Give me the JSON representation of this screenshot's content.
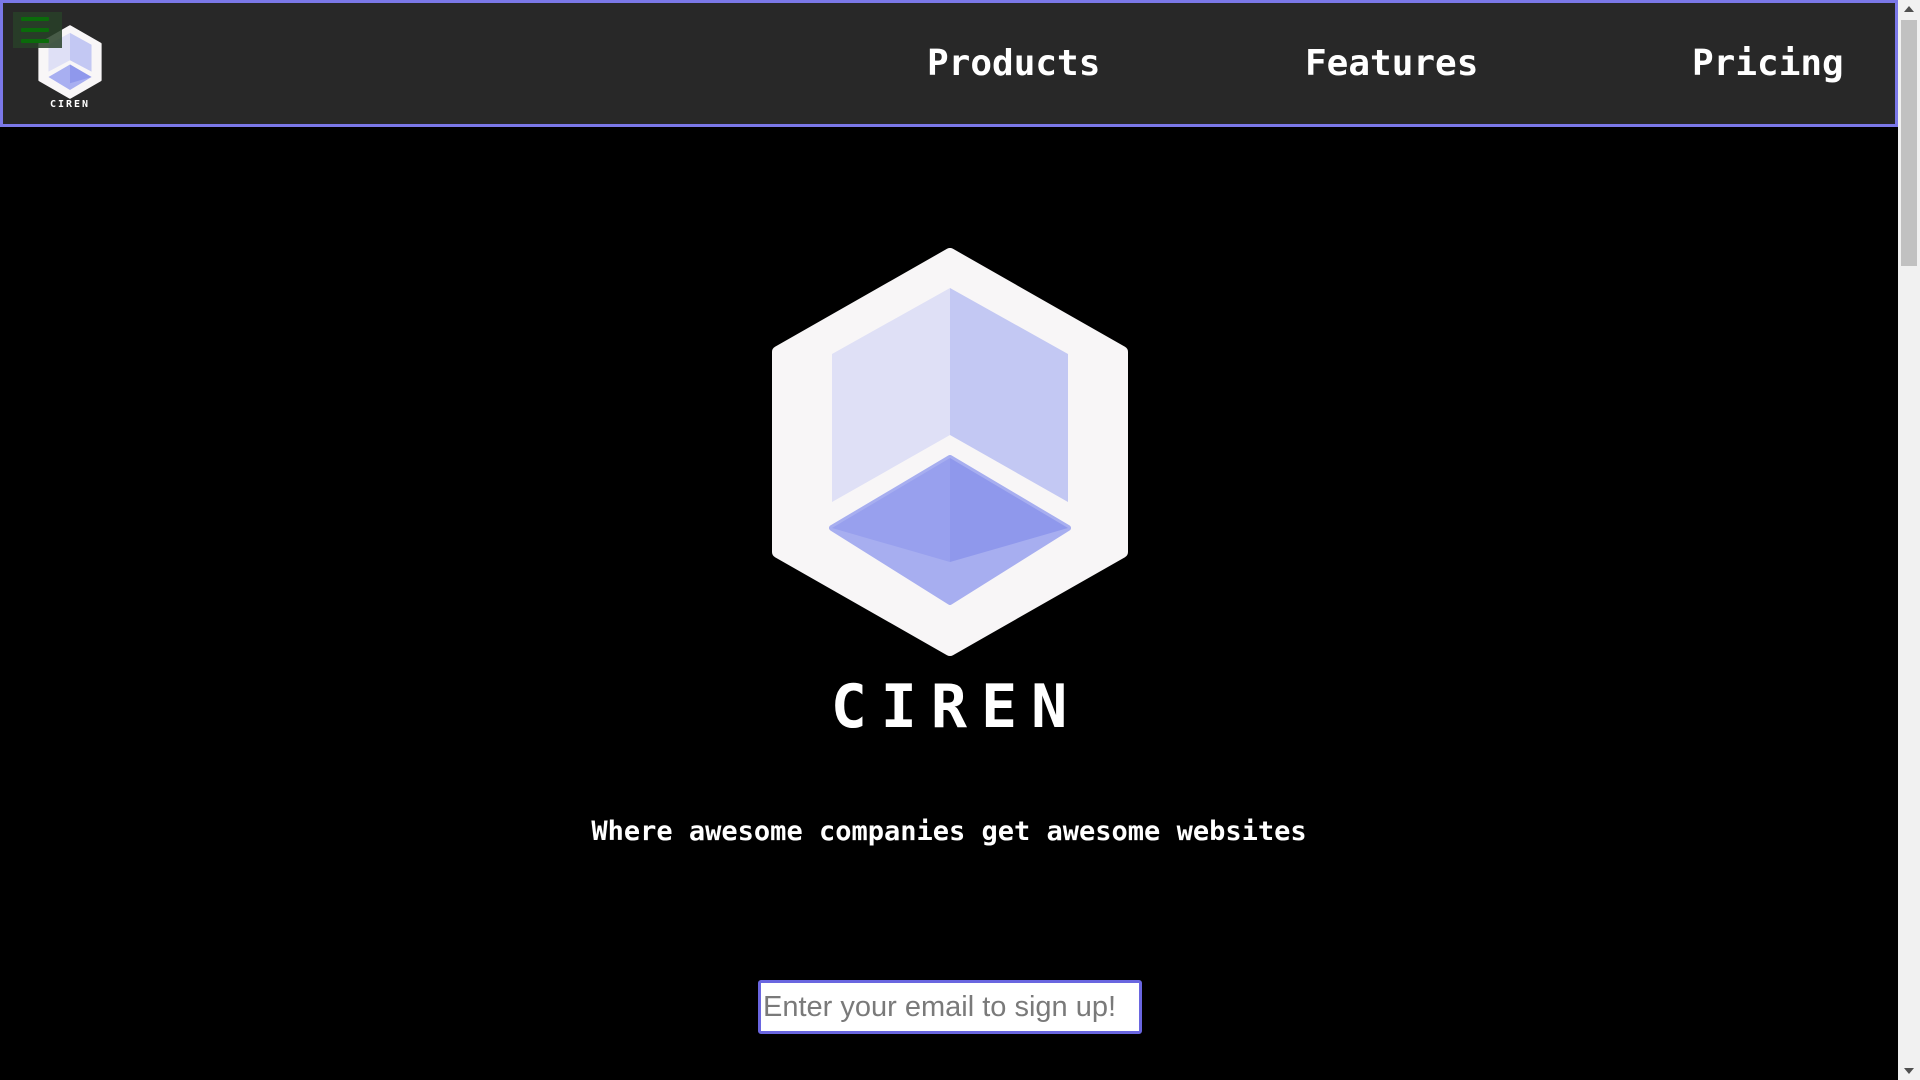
{
  "navbar": {
    "menu_icon": "hamburger-icon",
    "logo_text": "CIREN",
    "links": [
      {
        "label": "Products"
      },
      {
        "label": "Features"
      },
      {
        "label": "Pricing"
      }
    ]
  },
  "hero": {
    "logo_icon": "hexagon-cube-logo",
    "title": "CIREN",
    "tagline": "Where awesome companies get awesome websites"
  },
  "signup": {
    "email_placeholder": "Enter your email to sign up!",
    "email_value": ""
  },
  "colors": {
    "accent": "#7b78e8",
    "navbar_bg": "#282828",
    "page_bg": "#000000",
    "logo_hex": "#f8f6f7",
    "cube_light": "#dfe0f6",
    "cube_mid": "#c3c8f3",
    "cube_dark": "#8f98ec"
  }
}
